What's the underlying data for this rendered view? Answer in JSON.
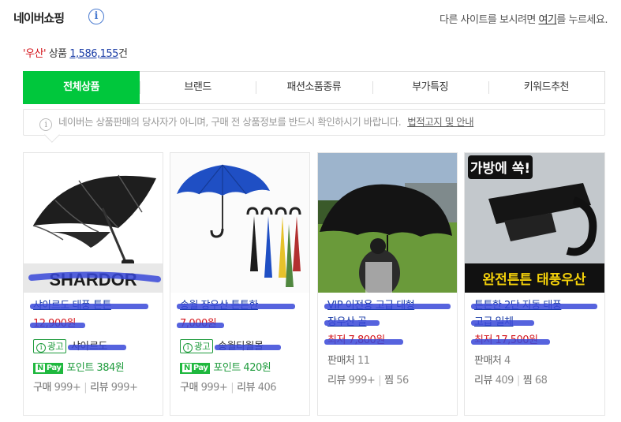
{
  "header": {
    "title": "네이버쇼핑",
    "right_text_pre": "다른 사이트를 보시려면 ",
    "right_link": "여기",
    "right_text_post": "를 누르세요."
  },
  "count": {
    "query": "'우산'",
    "label": " 상품 ",
    "value": "1,586,155",
    "unit": "건"
  },
  "tabs": [
    "전체상품",
    "브랜드",
    "패션소품종류",
    "부가특징",
    "키워드추천"
  ],
  "notice": {
    "text": "네이버는 상품판매의 당사자가 아니며, 구매 전 상품정보를 반드시 확인하시기 바랍니다.",
    "link": "법적고지 및 안내"
  },
  "cards": [
    {
      "title": "샤아르도 태풍 튼튼",
      "price": "12,900원",
      "ad_label": "광고",
      "mall": "샤아르도",
      "npay_points": "포인트 384원",
      "buy": "999+",
      "review": "999+",
      "banner": "SHARDOR"
    },
    {
      "title": "송월 장우산 튼튼한",
      "price": "7,000원",
      "ad_label": "광고",
      "mall": "송월타월몰",
      "npay_points": "포인트 420원",
      "buy": "999+",
      "review": "406"
    },
    {
      "title": "VIP 이전용 고급 대형",
      "title2": "장우산 골",
      "price": "최저 7,800원",
      "seller_count": "11",
      "review": "999+",
      "jjim": "56"
    },
    {
      "title": "튼튼한 2단 자동 태풍",
      "title2": "고급 일체",
      "price": "최저 17,500원",
      "seller_count": "4",
      "review": "409",
      "jjim": "68",
      "banner_top": "가방에 쏙!",
      "banner_bottom": "완전튼튼 태풍우산"
    }
  ],
  "labels": {
    "buy": "구매",
    "review": "리뷰",
    "seller": "판매처",
    "jjim": "찜",
    "npay": "Pay",
    "npay_n": "N"
  },
  "colors": {
    "accent": "#00c73c",
    "link": "#1a3ca6",
    "price": "#d4141b"
  }
}
